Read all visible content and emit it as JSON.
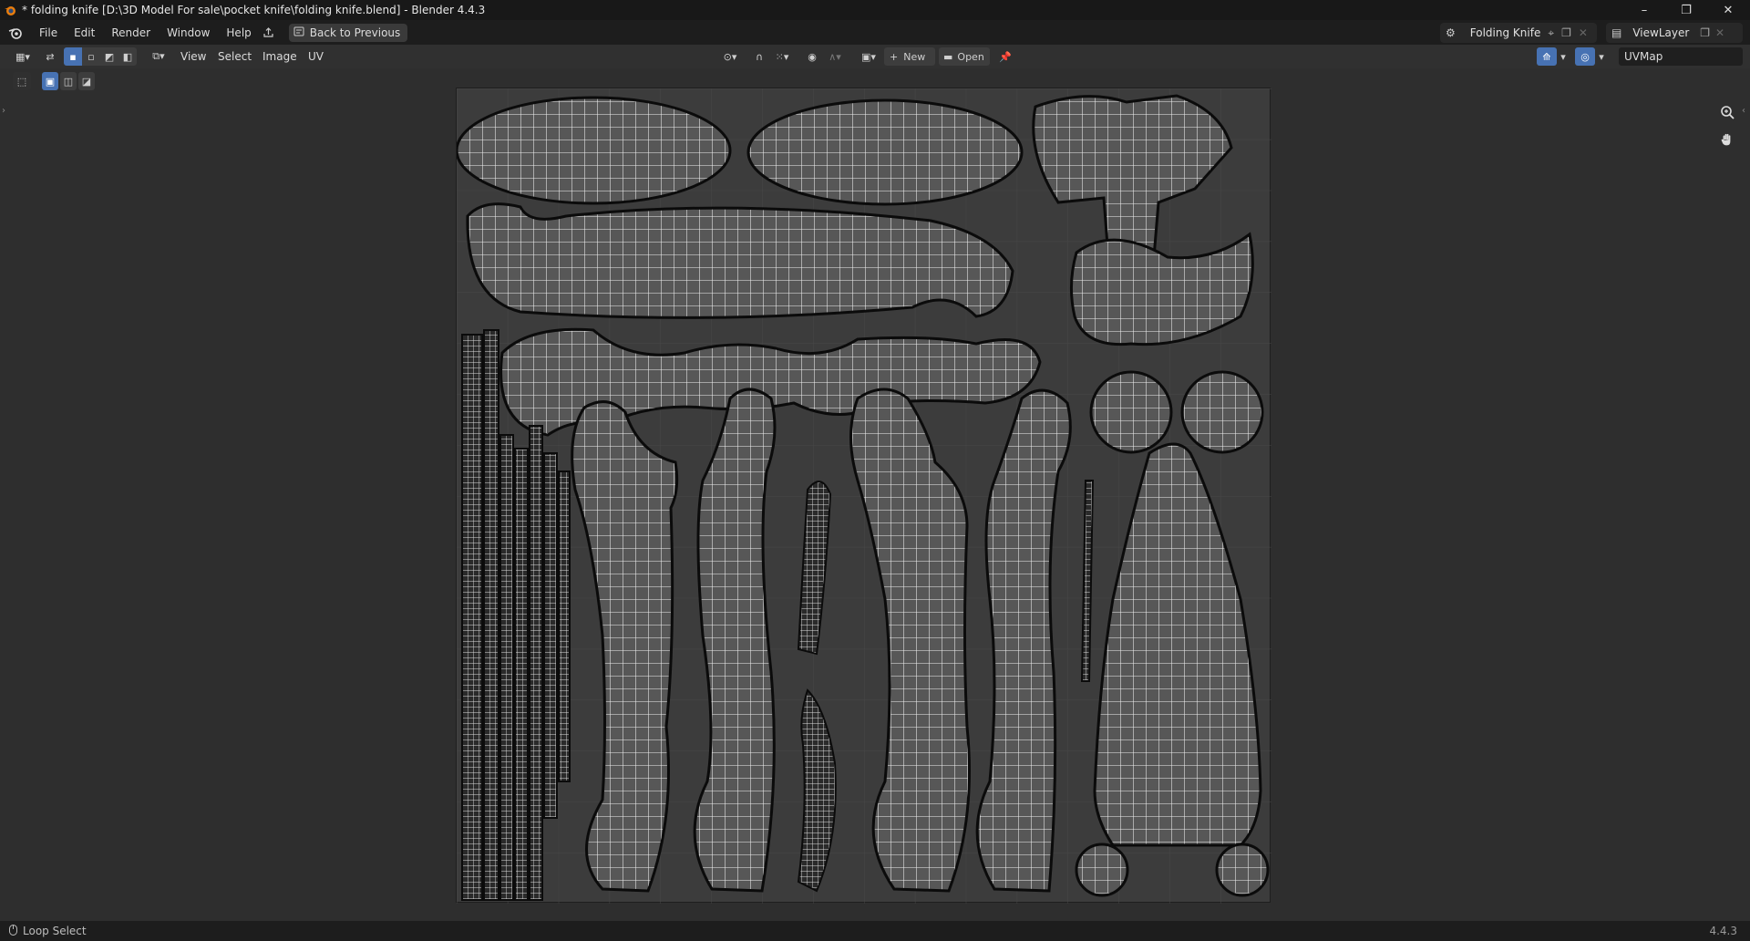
{
  "window": {
    "title": "* folding knife [D:\\3D Model For sale\\pocket knife\\folding knife.blend] - Blender 4.4.3",
    "minimize": "–",
    "maximize": "❐",
    "close": "✕"
  },
  "menu": {
    "items": [
      "File",
      "Edit",
      "Render",
      "Window",
      "Help"
    ],
    "back_label": "Back to Previous"
  },
  "scene": {
    "name": "Folding Knife",
    "view_layer": "ViewLayer"
  },
  "editor_header": {
    "view": "View",
    "select": "Select",
    "image": "Image",
    "uv": "UV",
    "new_label": "New",
    "open_label": "Open",
    "uv_map": "UVMap"
  },
  "status": {
    "hint": "Loop Select",
    "version": "4.4.3"
  },
  "icons": {
    "blender": "blender-logo-icon",
    "export": "export-icon",
    "zoom": "zoom-icon",
    "pan": "hand-icon"
  },
  "colors": {
    "accent": "#4772b3",
    "grid": "#3c3c3c",
    "wire": "#e8e8e8"
  }
}
